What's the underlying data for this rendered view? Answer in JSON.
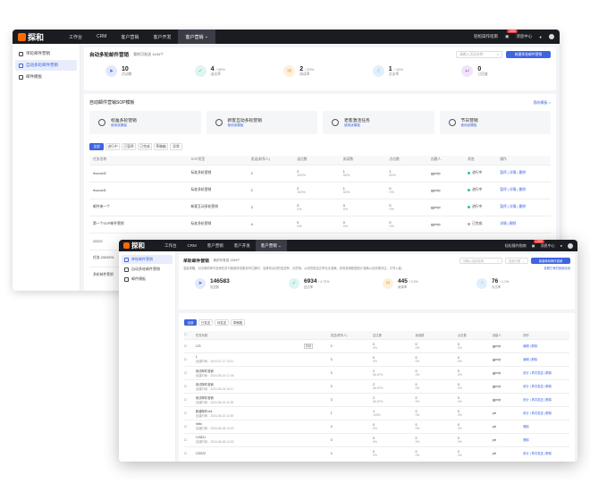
{
  "colors": {
    "accent": "#3e64e0",
    "dark_nav": "#1a1c22",
    "brand": "#ff6a00"
  },
  "back": {
    "brand": "探和",
    "nav": [
      "工作台",
      "CRM",
      "客户营销",
      "客户开发",
      "客户营销"
    ],
    "nav_active": 4,
    "top_right": [
      "轻松操作指南",
      "1999",
      "消息中心"
    ],
    "sidebar": [
      {
        "icon": "mail-icon",
        "label": "单轮邮件营销"
      },
      {
        "icon": "flow-icon",
        "label": "自动多轮邮件营销"
      },
      {
        "icon": "template-icon",
        "label": "邮件模板"
      }
    ],
    "sidebar_active": 1,
    "page_title": "自动多轮邮件营销",
    "page_sub": "我的可发送 1434个",
    "search_placeholder": "请输入活动名称",
    "create_button": "新建多轮邮件营销",
    "stats": [
      {
        "icon": "send-icon",
        "value": "10",
        "pct": "",
        "label": "活动数",
        "color": "#3e64e0"
      },
      {
        "icon": "check-icon",
        "value": "4",
        "pct": "/ 40%",
        "label": "送达率",
        "color": "#2cc0a8"
      },
      {
        "icon": "open-icon",
        "value": "2",
        "pct": "/ 20%",
        "label": "阅读率",
        "color": "#f5a623"
      },
      {
        "icon": "click-icon",
        "value": "1",
        "pct": "/ 10%",
        "label": "点击率",
        "color": "#3aa0f0"
      },
      {
        "icon": "reply-icon",
        "value": "0",
        "pct": "",
        "label": "已回复",
        "color": "#9b59d0"
      }
    ],
    "templates_title": "自动邮件营销SOP模板",
    "templates_more": "我的模板 >",
    "templates": [
      {
        "name": "标准多轮营销",
        "link": "使用该模板"
      },
      {
        "name": "新客互动多轮营销",
        "link": "使用该模板"
      },
      {
        "name": "老客激活任务",
        "link": "使用该模板"
      },
      {
        "name": "节日营销",
        "link": "使用该模板"
      }
    ],
    "tabs": [
      "全部",
      "进行中",
      "已暂停",
      "已完成",
      "草稿箱",
      "异常"
    ],
    "tabs_active": 0,
    "table": {
      "headers": [
        "任务名称",
        "SOP类型",
        "发送(联系人)",
        "送达数",
        "阅读数",
        "点击数",
        "创建人",
        "状态",
        "操作"
      ],
      "rows": [
        {
          "name": "rtuuuvd2",
          "type": "标准多轮营销",
          "send": "2",
          "deliver": "2",
          "deliver_pct": "100%",
          "read": "1",
          "read_pct": "50%",
          "click": "1",
          "click_pct": "50%",
          "owner": "gjpmjx",
          "status": "进行中",
          "ops": "暂停 | 详情 | 删除"
        },
        {
          "name": "rtuuuvd1",
          "type": "标准多轮营销",
          "send": "2",
          "deliver": "2",
          "deliver_pct": "100%",
          "read": "1",
          "read_pct": "50%",
          "click": "0",
          "click_pct": "0%",
          "owner": "gjpmjx",
          "status": "进行中",
          "ops": "暂停 | 详情 | 删除"
        },
        {
          "name": "邮件来一个",
          "type": "新客互动多轮营销",
          "send": "3",
          "deliver": "0",
          "deliver_pct": "0%",
          "read": "0",
          "read_pct": "0%",
          "click": "0",
          "click_pct": "0%",
          "owner": "gjpmjx",
          "status": "进行中",
          "ops": "暂停 | 详情 | 删除"
        },
        {
          "name": "第一个SOP邮件营销",
          "type": "标准多轮营销",
          "send": "4",
          "deliver": "0",
          "deliver_pct": "0%",
          "read": "0",
          "read_pct": "0%",
          "click": "0",
          "click_pct": "0%",
          "owner": "gjpmjx",
          "status": "已完成",
          "ops": "详情 | 删除"
        }
      ],
      "extra_rows": [
        "22222",
        "任务-2324201",
        "多轮邮件营销"
      ]
    }
  },
  "front": {
    "brand": "探和",
    "nav": [
      "工作台",
      "CRM",
      "客户营销",
      "客户开发",
      "客户营销"
    ],
    "nav_active": 4,
    "top_right": [
      "轻松操作指南",
      "1999",
      "消息中心"
    ],
    "sidebar": [
      {
        "icon": "mail-icon",
        "label": "单轮邮件营销"
      },
      {
        "icon": "flow-icon",
        "label": "自动多轮邮件营销"
      },
      {
        "icon": "template-icon",
        "label": "邮件模板"
      }
    ],
    "sidebar_active": 0,
    "page_title": "单轮邮件营销",
    "page_sub": "我的可发送 1434个",
    "notice": "温馨提醒：对当单前邮件营销任务可能被收信服务商拦截时，会降低活动的发送率，请谨慎。从而导致送达率无法准确，影响营销数据统计准确以及效果评估，引导入客。",
    "search_placeholder": "请输入活动名称",
    "filter_placeholder": "全部分类",
    "create_button": "新建单轮邮件营销",
    "link_more": "查看已有的营销活动",
    "stats": [
      {
        "icon": "send-icon",
        "value": "146583",
        "pct": "",
        "label": "发送数",
        "color": "#3e64e0"
      },
      {
        "icon": "check-icon",
        "value": "6934",
        "pct": "/ 4.73%",
        "label": "送达率",
        "color": "#2cc0a8"
      },
      {
        "icon": "open-icon",
        "value": "445",
        "pct": "/ 0.3%",
        "label": "阅读率",
        "color": "#f5a623"
      },
      {
        "icon": "click-icon",
        "value": "76",
        "pct": "/ 1.1%",
        "label": "点击率",
        "color": "#3aa0f0"
      }
    ],
    "tabs": [
      "全部",
      "已发送",
      "待发送",
      "草稿箱"
    ],
    "tabs_active": 0,
    "table": {
      "headers": [
        "",
        "任务标题",
        "",
        "发送(联系人)",
        "送达数",
        "阅读数",
        "点击数",
        "创建人",
        "操作"
      ],
      "rows": [
        {
          "name": "123",
          "date": "",
          "tag": "草稿",
          "send": "0",
          "deliver": "0",
          "deliver_pct": "0%",
          "read": "0",
          "read_pct": "0%",
          "click": "0",
          "click_pct": "0%",
          "owner": "gjpmjx",
          "ops": "编辑 | 删除"
        },
        {
          "name": "1",
          "date": "创建时间：2024-07-17 13:11",
          "tag": "",
          "send": "3",
          "deliver": "0",
          "deliver_pct": "0%",
          "read": "0",
          "read_pct": "0%",
          "click": "0",
          "click_pct": "0%",
          "owner": "gjpmjx",
          "ops": "编辑 | 删除"
        },
        {
          "name": "测试邮件营销",
          "date": "创建时间：2024-06-14 17:04",
          "tag": "",
          "send": "3",
          "deliver": "2",
          "deliver_pct": "66.67%",
          "read": "0",
          "read_pct": "0%",
          "click": "0",
          "click_pct": "0%",
          "owner": "gjpmjx",
          "ops": "统计 | 再次发送 | 删除"
        },
        {
          "name": "测试邮件营销",
          "date": "创建时间：2024-06-13 16:17",
          "tag": "",
          "send": "3",
          "deliver": "2",
          "deliver_pct": "66.67%",
          "read": "0",
          "read_pct": "0%",
          "click": "0",
          "click_pct": "0%",
          "owner": "gjpmjx",
          "ops": "统计 | 再次发送 | 删除"
        },
        {
          "name": "测试邮件营销",
          "date": "创建时间：2024-06-13 11:39",
          "tag": "",
          "send": "3",
          "deliver": "2",
          "deliver_pct": "66.67%",
          "read": "0",
          "read_pct": "0%",
          "click": "0",
          "click_pct": "0%",
          "owner": "gjpmjx",
          "ops": "统计 | 再次发送 | 删除"
        },
        {
          "name": "新建邮件ce4",
          "date": "创建时间：2024-06-12 11:39",
          "tag": "",
          "send": "1",
          "deliver": "1",
          "deliver_pct": "100%",
          "read": "0",
          "read_pct": "0%",
          "click": "0",
          "click_pct": "0%",
          "owner": "pei",
          "ops": "统计 | 再次发送 | 删除"
        },
        {
          "name": "hello",
          "date": "创建时间：2024-06-08 13:20",
          "tag": "",
          "send": "0",
          "deliver": "0",
          "deliver_pct": "0%",
          "read": "0",
          "read_pct": "0%",
          "click": "0",
          "click_pct": "0%",
          "owner": "pei",
          "ops": "删除"
        },
        {
          "name": "123321",
          "date": "创建时间：2024-06-06 14:32",
          "tag": "",
          "send": "0",
          "deliver": "0",
          "deliver_pct": "0%",
          "read": "0",
          "read_pct": "0%",
          "click": "0",
          "click_pct": "0%",
          "owner": "pei",
          "ops": "删除"
        },
        {
          "name": "122222",
          "date": "",
          "tag": "",
          "send": "4",
          "deliver": "0",
          "deliver_pct": "0%",
          "read": "0",
          "read_pct": "0%",
          "click": "0",
          "click_pct": "0%",
          "owner": "pei",
          "ops": "统计 | 再次发送 | 删除"
        }
      ]
    }
  }
}
